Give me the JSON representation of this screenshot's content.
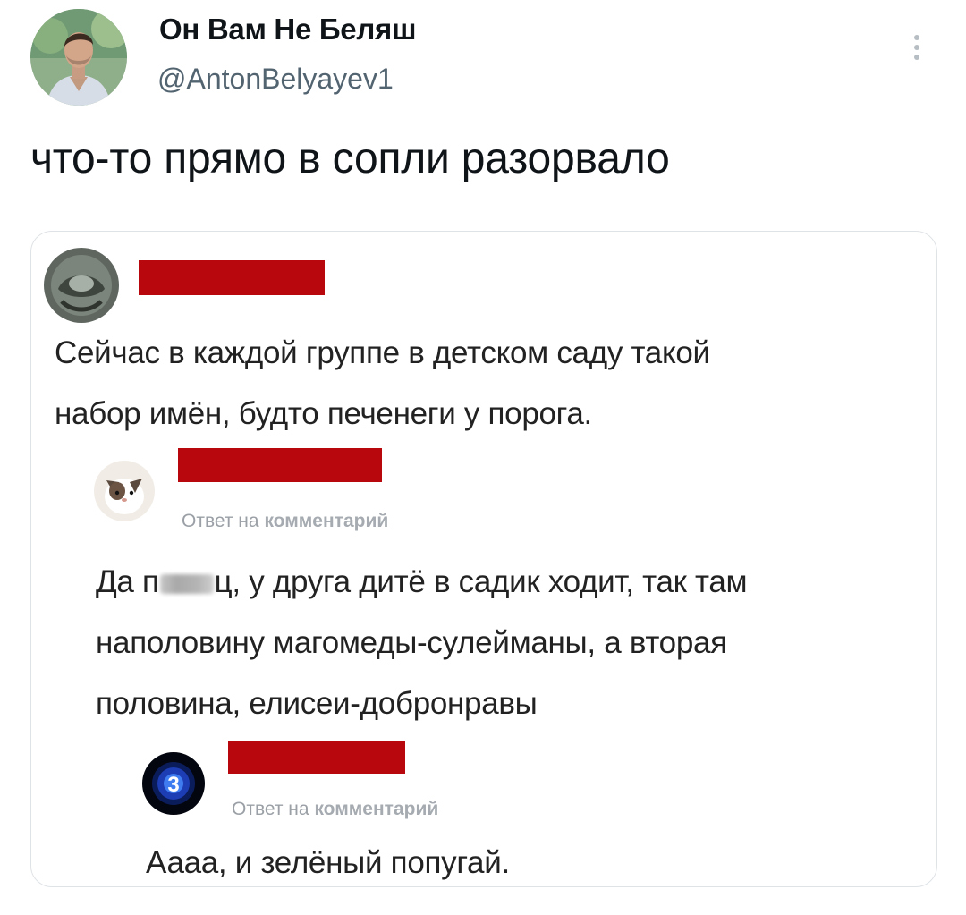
{
  "tweet": {
    "display_name": "Он Вам Не Беляш",
    "handle": "@AntonBelyayev1",
    "text": "что-то прямо в сопли разорвало",
    "more_icon": "vertical-ellipsis-icon"
  },
  "embedded_screenshot": {
    "comments": [
      {
        "author": "",
        "avatar_icon": "dark-profile-avatar",
        "lines": [
          "Сейчас в каждой группе в детском саду такой",
          "набор имён, будто печенеги у порога."
        ]
      },
      {
        "author": "",
        "avatar_icon": "cat-profile-avatar",
        "reply_prefix": "Ответ на",
        "reply_suffix": "комментарий",
        "lines_first_before_censor": "Да п",
        "lines_first_after_censor": "ц, у друга дитё в садик ходит, так там",
        "lines": [
          "наполовину магомеды-сулейманы, а вторая",
          "половина, елисеи-добронравы"
        ]
      },
      {
        "author": "",
        "avatar_icon": "blue-number-avatar",
        "avatar_glyph": "3",
        "reply_prefix": "Ответ на",
        "reply_suffix": "комментарий",
        "lines": [
          "Аааа, и зелёный попугай."
        ]
      }
    ],
    "redaction_color": "#b8070d"
  }
}
